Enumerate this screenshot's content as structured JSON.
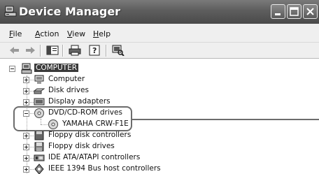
{
  "window": {
    "title": "Device Manager"
  },
  "menu": {
    "file": "File",
    "action": "Action",
    "view": "View",
    "help": "Help"
  },
  "tree": {
    "root": "COMPUTER",
    "items": [
      {
        "label": "Computer",
        "icon": "computer-icon"
      },
      {
        "label": "Disk drives",
        "icon": "disk-drive-icon"
      },
      {
        "label": "Display adapters",
        "icon": "display-adapter-icon"
      },
      {
        "label": "DVD/CD-ROM drives",
        "icon": "cd-drive-icon",
        "expanded": true,
        "children": [
          {
            "label": "YAMAHA CRW-F1E",
            "icon": "cd-drive-icon"
          }
        ]
      },
      {
        "label": "Floppy disk controllers",
        "icon": "floppy-controller-icon"
      },
      {
        "label": "Floppy disk drives",
        "icon": "floppy-drive-icon"
      },
      {
        "label": "IDE ATA/ATAPI controllers",
        "icon": "ide-controller-icon"
      },
      {
        "label": "IEEE 1394 Bus host controllers",
        "icon": "ieee1394-icon"
      }
    ]
  },
  "colors": {
    "titlebar": "#5d5d5d",
    "selection": "#3a3a3a",
    "callout": "#6c6c6c"
  }
}
